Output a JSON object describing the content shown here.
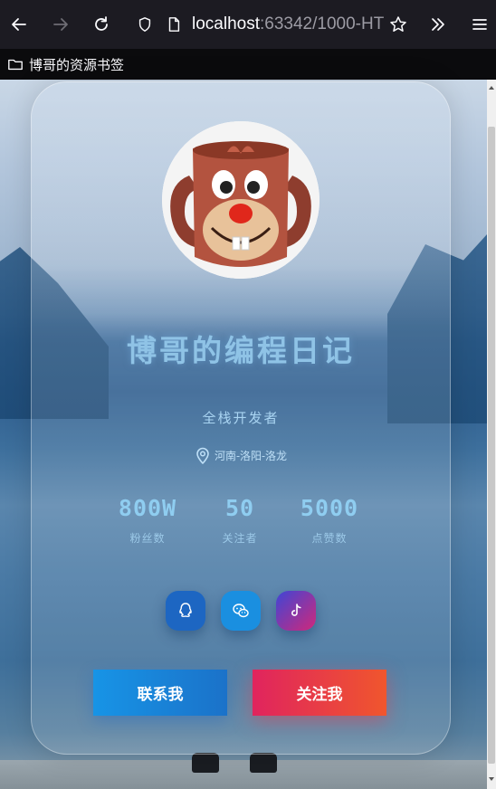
{
  "browser": {
    "url_host": "localhost",
    "url_rest": ":63342/1000-HT",
    "bookmark_label": "博哥的资源书签"
  },
  "profile": {
    "name": "博哥的编程日记",
    "role": "全栈开发者",
    "location": "河南-洛阳-洛龙",
    "stats": [
      {
        "value": "800W",
        "label": "粉丝数"
      },
      {
        "value": "50",
        "label": "关注者"
      },
      {
        "value": "5000",
        "label": "点赞数"
      }
    ],
    "social": [
      {
        "icon": "qq-icon",
        "color": "#1d66c2"
      },
      {
        "icon": "wechat-icon",
        "color": "#1a8fe0"
      },
      {
        "icon": "tiktok-icon",
        "color": "#c1307a"
      }
    ],
    "buttons": {
      "contact": "联系我",
      "follow": "关注我"
    }
  },
  "colors": {
    "accent_blue": "#1794e6",
    "accent_red": "#e0245e",
    "title": "#8fc3e6"
  }
}
